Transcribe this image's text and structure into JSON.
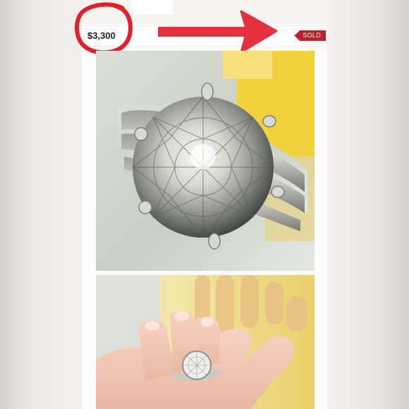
{
  "listing": {
    "price": "$3,300",
    "status_badge": "SOLD"
  },
  "annotations": {
    "circle_color": "#e0202b",
    "arrow_color": "#e53040"
  },
  "photos": [
    {
      "subject": "ring-closeup"
    },
    {
      "subject": "ring-on-hand"
    }
  ],
  "colors": {
    "badge": "#b8222a",
    "accent_yellow": "#f1d64a"
  }
}
